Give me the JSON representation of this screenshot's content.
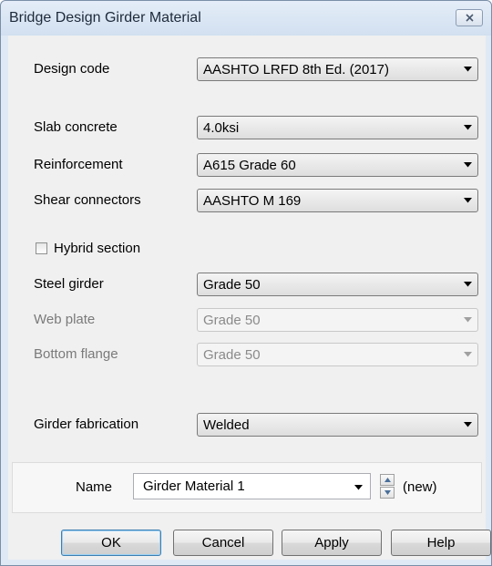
{
  "window": {
    "title": "Bridge Design Girder Material",
    "close_icon": "close-x-icon"
  },
  "fields": {
    "design_code": {
      "label": "Design code",
      "value": "AASHTO LRFD 8th Ed. (2017)",
      "enabled": true
    },
    "slab_concrete": {
      "label": "Slab concrete",
      "value": "4.0ksi",
      "enabled": true
    },
    "reinforcement": {
      "label": "Reinforcement",
      "value": "A615 Grade 60",
      "enabled": true
    },
    "shear_connectors": {
      "label": "Shear connectors",
      "value": "AASHTO M 169",
      "enabled": true
    },
    "hybrid_section": {
      "label": "Hybrid section",
      "checked": false
    },
    "steel_girder": {
      "label": "Steel girder",
      "value": "Grade 50",
      "enabled": true
    },
    "web_plate": {
      "label": "Web plate",
      "value": "Grade 50",
      "enabled": false
    },
    "bottom_flange": {
      "label": "Bottom flange",
      "value": "Grade 50",
      "enabled": false
    },
    "girder_fabrication": {
      "label": "Girder fabrication",
      "value": "Welded",
      "enabled": true
    }
  },
  "name_panel": {
    "label": "Name",
    "value": "Girder Material 1",
    "status": "(new)"
  },
  "buttons": {
    "ok": "OK",
    "cancel": "Cancel",
    "apply": "Apply",
    "help": "Help"
  }
}
